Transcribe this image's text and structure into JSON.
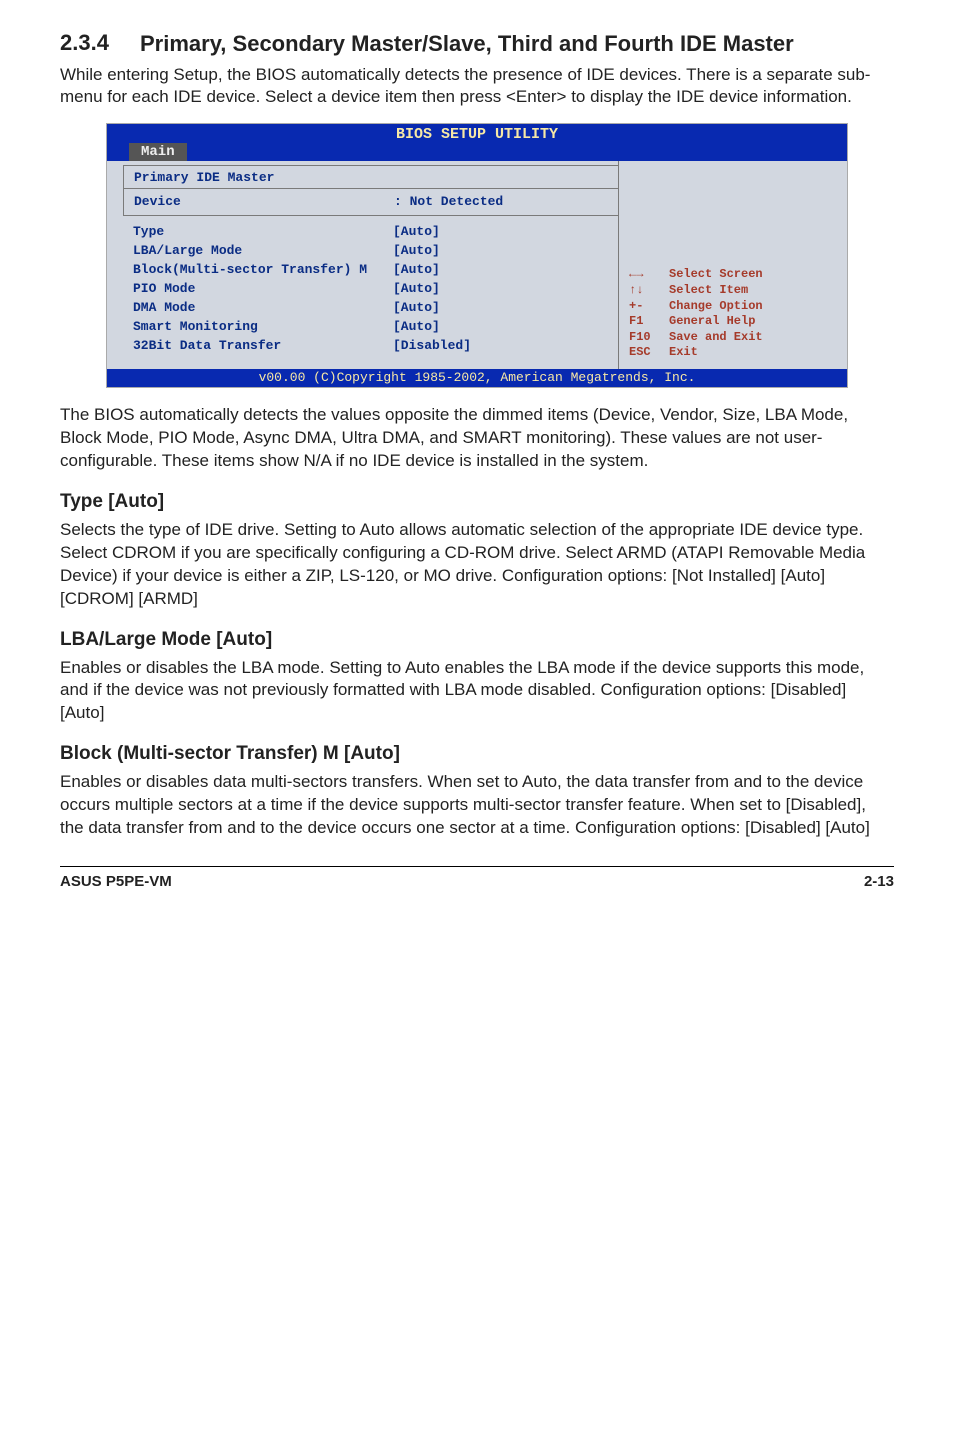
{
  "section": {
    "number": "2.3.4",
    "title": "Primary, Secondary Master/Slave, Third and Fourth IDE Master",
    "intro": "While entering Setup, the BIOS automatically detects the presence of IDE devices. There is a separate sub-menu for each IDE device. Select a device item then press <Enter> to display the IDE device information."
  },
  "bios": {
    "header": "BIOS SETUP UTILITY",
    "tab": "Main",
    "panel_title": "Primary IDE Master",
    "device_label": "Device",
    "device_value": ": Not Detected",
    "rows": [
      {
        "label": "Type",
        "value": "[Auto]"
      },
      {
        "label": "LBA/Large Mode",
        "value": "[Auto]"
      },
      {
        "label": "Block(Multi-sector Transfer) M",
        "value": "[Auto]"
      },
      {
        "label": "PIO Mode",
        "value": "[Auto]"
      },
      {
        "label": "DMA Mode",
        "value": "[Auto]"
      },
      {
        "label": "Smart Monitoring",
        "value": "[Auto]"
      },
      {
        "label": "32Bit Data Transfer",
        "value": "[Disabled]"
      }
    ],
    "legend": [
      {
        "key": "←→",
        "desc": "Select Screen"
      },
      {
        "key": "↑↓",
        "desc": "Select Item"
      },
      {
        "key": "+-",
        "desc": "Change Option"
      },
      {
        "key": "F1",
        "desc": "General Help"
      },
      {
        "key": "F10",
        "desc": "Save and Exit"
      },
      {
        "key": "ESC",
        "desc": "Exit"
      }
    ],
    "footer": "v00.00 (C)Copyright 1985-2002, American Megatrends, Inc."
  },
  "after_bios": "The BIOS automatically detects the values opposite the dimmed items (Device, Vendor, Size, LBA Mode, Block Mode, PIO Mode, Async DMA, Ultra DMA, and SMART monitoring). These values are not user-configurable. These items show N/A if no IDE device is installed in the system.",
  "type": {
    "heading": "Type [Auto]",
    "body": "Selects the type of IDE drive. Setting to Auto allows automatic selection of the appropriate IDE device type. Select CDROM if you are specifically configuring a CD-ROM drive. Select ARMD (ATAPI Removable Media Device) if your device is either a ZIP, LS-120, or MO drive. Configuration options: [Not Installed] [Auto] [CDROM] [ARMD]"
  },
  "lba": {
    "heading": "LBA/Large Mode [Auto]",
    "body": "Enables or disables the LBA mode. Setting to Auto enables the LBA mode if the device supports this mode, and if the device was not previously formatted with LBA mode disabled. Configuration options: [Disabled] [Auto]"
  },
  "block": {
    "heading": "Block (Multi-sector Transfer) M [Auto]",
    "body": "Enables or disables data multi-sectors transfers. When set to Auto, the data transfer from and to the device occurs multiple sectors at a time if the device supports multi-sector transfer feature. When set to [Disabled], the data transfer from and to the device occurs one sector at a time. Configuration options: [Disabled] [Auto]"
  },
  "footer": {
    "left": "ASUS P5PE-VM",
    "right": "2-13"
  }
}
